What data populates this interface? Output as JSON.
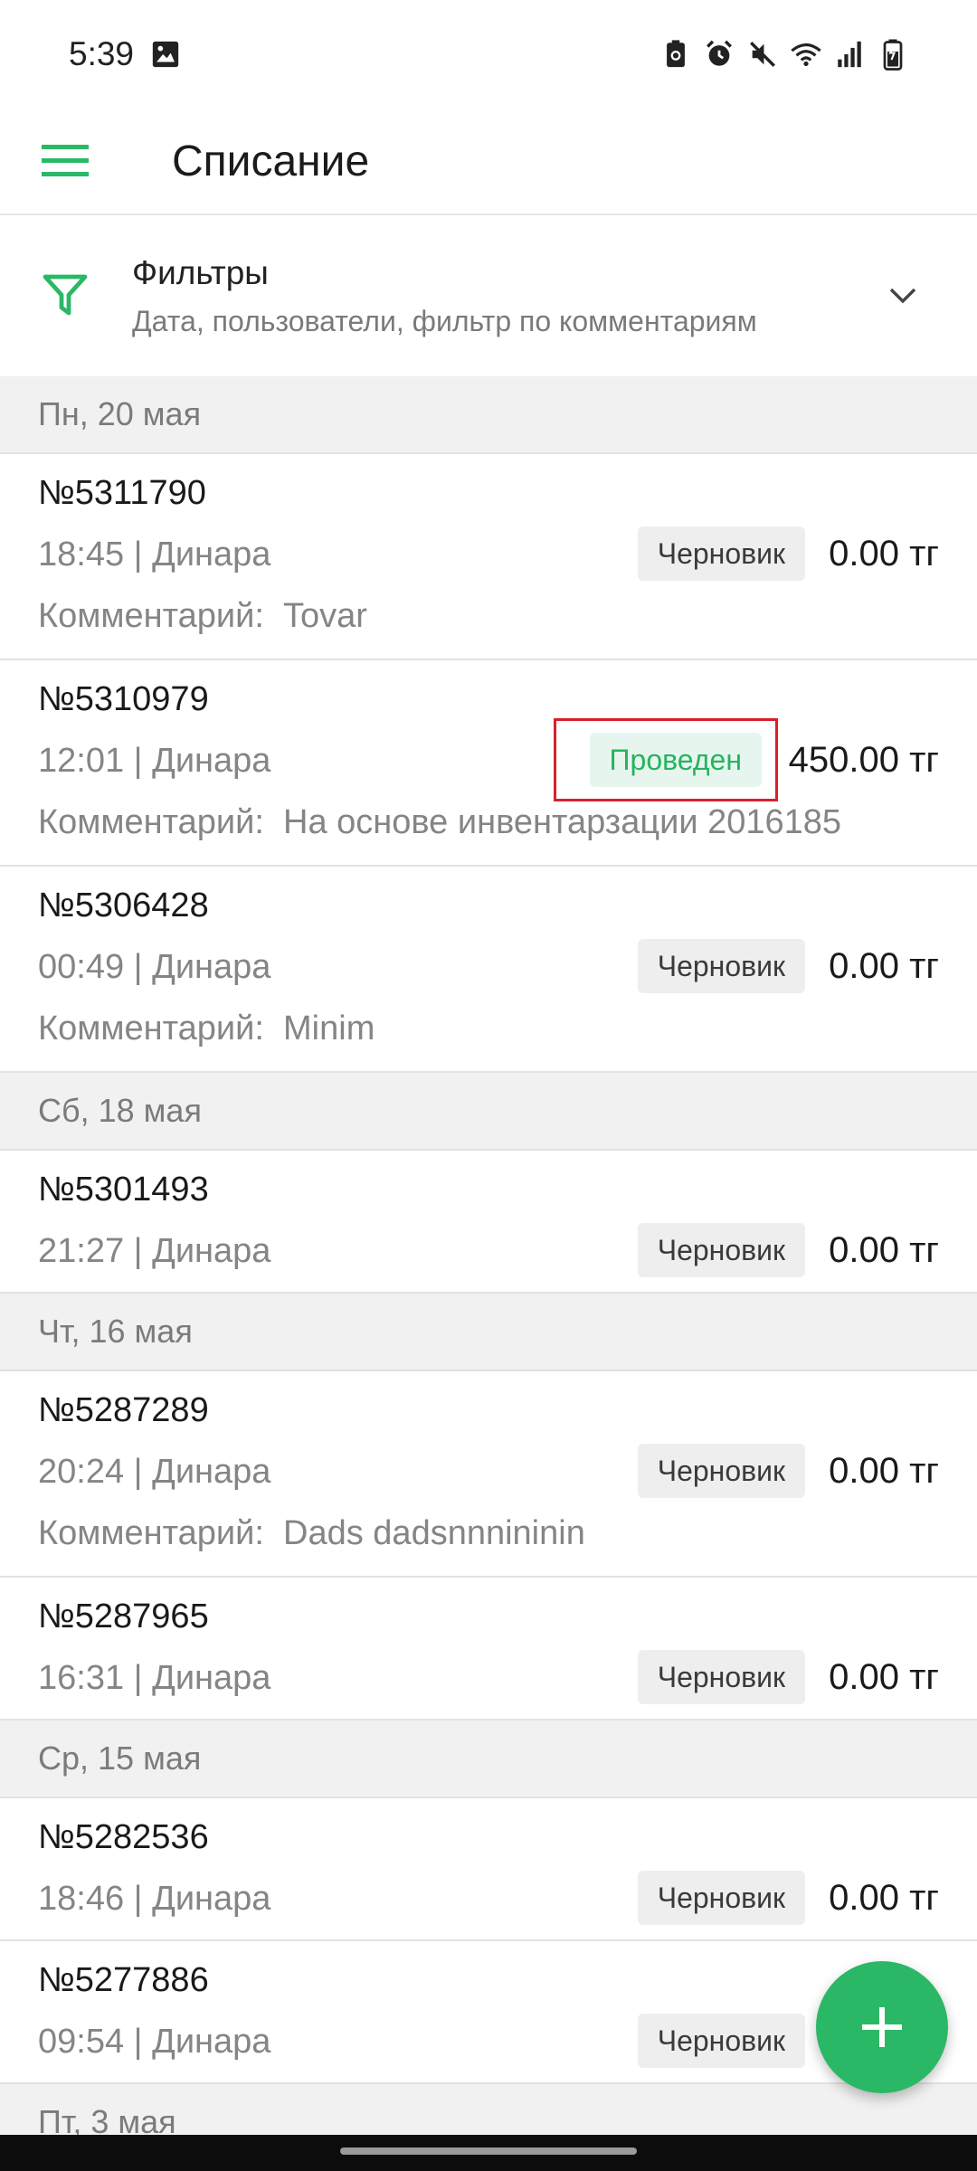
{
  "status_bar": {
    "time": "5:39",
    "icons_left": [
      "image-icon"
    ],
    "icons_right": [
      "battery-saver-icon",
      "alarm-icon",
      "mute-icon",
      "wifi-icon",
      "signal-icon",
      "battery-icon"
    ]
  },
  "app_bar": {
    "title": "Списание",
    "menu_icon": "menu-icon"
  },
  "filters": {
    "title": "Фильтры",
    "subtitle": "Дата, пользователи, фильтр по комментариям",
    "icon": "filter-icon",
    "chevron": "chevron-down-icon"
  },
  "groups": [
    {
      "date": "Пн, 20 мая",
      "items": [
        {
          "number": "№5311790",
          "meta": "18:45 | Динара",
          "status": "Черновик",
          "amount": "0.00 тг",
          "comment_label": "Комментарий:",
          "comment": "Tovar"
        },
        {
          "number": "№5310979",
          "meta": "12:01 | Динара",
          "status": "Проведен",
          "amount": "450.00 тг",
          "comment_label": "Комментарий:",
          "comment": "На основе инвентарзации 2016185"
        },
        {
          "number": "№5306428",
          "meta": "00:49 | Динара",
          "status": "Черновик",
          "amount": "0.00 тг",
          "comment_label": "Комментарий:",
          "comment": "Minim"
        }
      ]
    },
    {
      "date": "Сб, 18 мая",
      "items": [
        {
          "number": "№5301493",
          "meta": "21:27 | Динара",
          "status": "Черновик",
          "amount": "0.00 тг"
        }
      ]
    },
    {
      "date": "Чт, 16 мая",
      "items": [
        {
          "number": "№5287289",
          "meta": "20:24 | Динара",
          "status": "Черновик",
          "amount": "0.00 тг",
          "comment_label": "Комментарий:",
          "comment": "Dads dadsnnnininin"
        },
        {
          "number": "№5287965",
          "meta": "16:31 | Динара",
          "status": "Черновик",
          "amount": "0.00 тг"
        }
      ]
    },
    {
      "date": "Ср, 15 мая",
      "items": [
        {
          "number": "№5282536",
          "meta": "18:46 | Динара",
          "status": "Черновик",
          "amount": "0.00 тг"
        },
        {
          "number": "№5277886",
          "meta": "09:54 | Динара",
          "status": "Черновик",
          "amount": ""
        }
      ]
    },
    {
      "date": "Пт, 3 мая",
      "items": []
    }
  ],
  "fab": {
    "icon": "plus-icon"
  },
  "colors": {
    "accent": "#2bb866",
    "draft_badge_bg": "#eeeeee",
    "done_badge_bg": "#e6f6ee",
    "done_badge_text": "#27b35f",
    "highlight": "#d9202a"
  }
}
